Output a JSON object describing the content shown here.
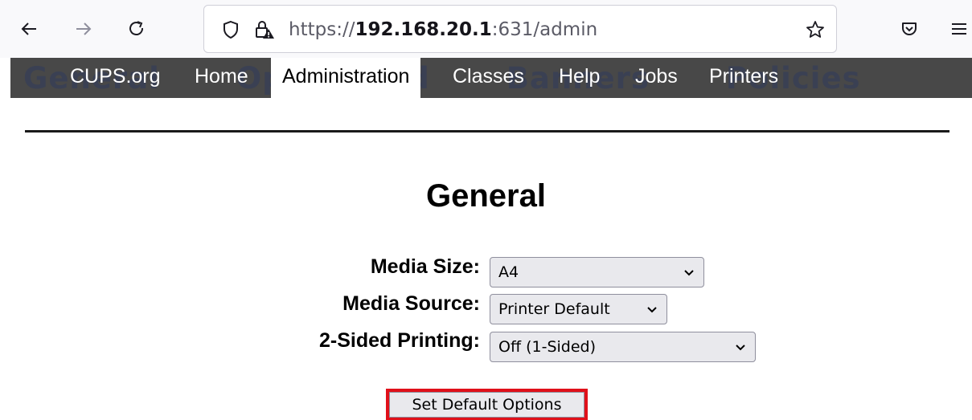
{
  "browser": {
    "url_scheme": "https://",
    "url_host": "192.168.20.1",
    "url_rest": ":631/admin"
  },
  "nav": {
    "items": [
      "CUPS.org",
      "Home",
      "Administration",
      "Classes",
      "Help",
      "Jobs",
      "Printers"
    ],
    "active": "Administration",
    "background_text": [
      "General",
      "Opti",
      "ed",
      "Banners",
      "Policies"
    ],
    "bar_color": "#484848"
  },
  "page": {
    "title": "General",
    "fields": [
      {
        "label": "Media Size:",
        "value": "A4"
      },
      {
        "label": "Media Source:",
        "value": "Printer Default"
      },
      {
        "label": "2-Sided Printing:",
        "value": "Off (1-Sided)"
      }
    ],
    "submit_label": "Set Default Options",
    "highlight_color": "#e0101a"
  },
  "icons": {
    "back": "arrow-left-icon",
    "forward": "arrow-right-icon",
    "reload": "reload-icon",
    "shield": "tracking-shield-icon",
    "lock": "lock-warning-icon",
    "bookmark": "star-icon",
    "pocket": "pocket-icon",
    "menu": "hamburger-menu-icon"
  }
}
